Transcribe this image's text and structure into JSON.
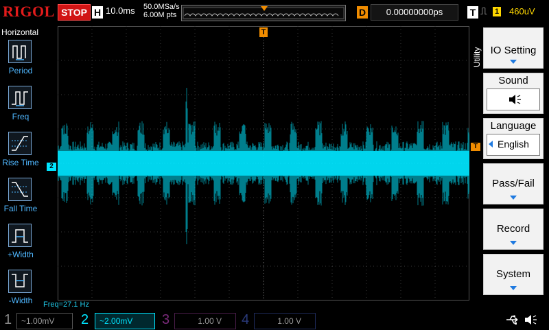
{
  "top": {
    "logo": "RIGOL",
    "run_status": "STOP",
    "horizontal_label": "H",
    "timebase": "10.0ms",
    "sample_rate": "50.0MSa/s",
    "memory_depth": "6.00M pts",
    "delay_label": "D",
    "delay_value": "0.00000000ps",
    "trigger_label": "T",
    "trigger_edge": "⎍",
    "trigger_source": "1",
    "trigger_level": "460uV",
    "trigger_position_marker": "T"
  },
  "left_menu": {
    "title": "Horizontal",
    "items": [
      {
        "label": "Period"
      },
      {
        "label": "Freq"
      },
      {
        "label": "Rise Time"
      },
      {
        "label": "Fall Time"
      },
      {
        "label": "+Width"
      },
      {
        "label": "-Width"
      }
    ]
  },
  "right_menu": {
    "tab_label": "Utility",
    "items": [
      {
        "label": "IO Setting"
      },
      {
        "label": "Sound",
        "value_icon": "speaker-icon"
      },
      {
        "label": "Language",
        "value": "English"
      },
      {
        "label": "Pass/Fail"
      },
      {
        "label": "Record"
      },
      {
        "label": "System"
      }
    ]
  },
  "waveform": {
    "channel_marker": "2",
    "trigger_marker": "T",
    "color": "#00e5ff",
    "freq_readout": "Freq=27.1 Hz"
  },
  "channels": [
    {
      "num": "1",
      "coupling": "~",
      "scale": "1.00mV",
      "color": "#9a9a9a"
    },
    {
      "num": "2",
      "coupling": "~",
      "scale": "2.00mV",
      "color": "#00e5ff"
    },
    {
      "num": "3",
      "coupling": "",
      "scale": "1.00 V",
      "color": "#d040d0"
    },
    {
      "num": "4",
      "coupling": "",
      "scale": "1.00 V",
      "color": "#3a66e0"
    }
  ],
  "colors": {
    "accent_red": "#d11414",
    "trigger_orange": "#f08c00",
    "trigger_yellow": "#ffd800",
    "menu_blue": "#4fb7ff"
  }
}
